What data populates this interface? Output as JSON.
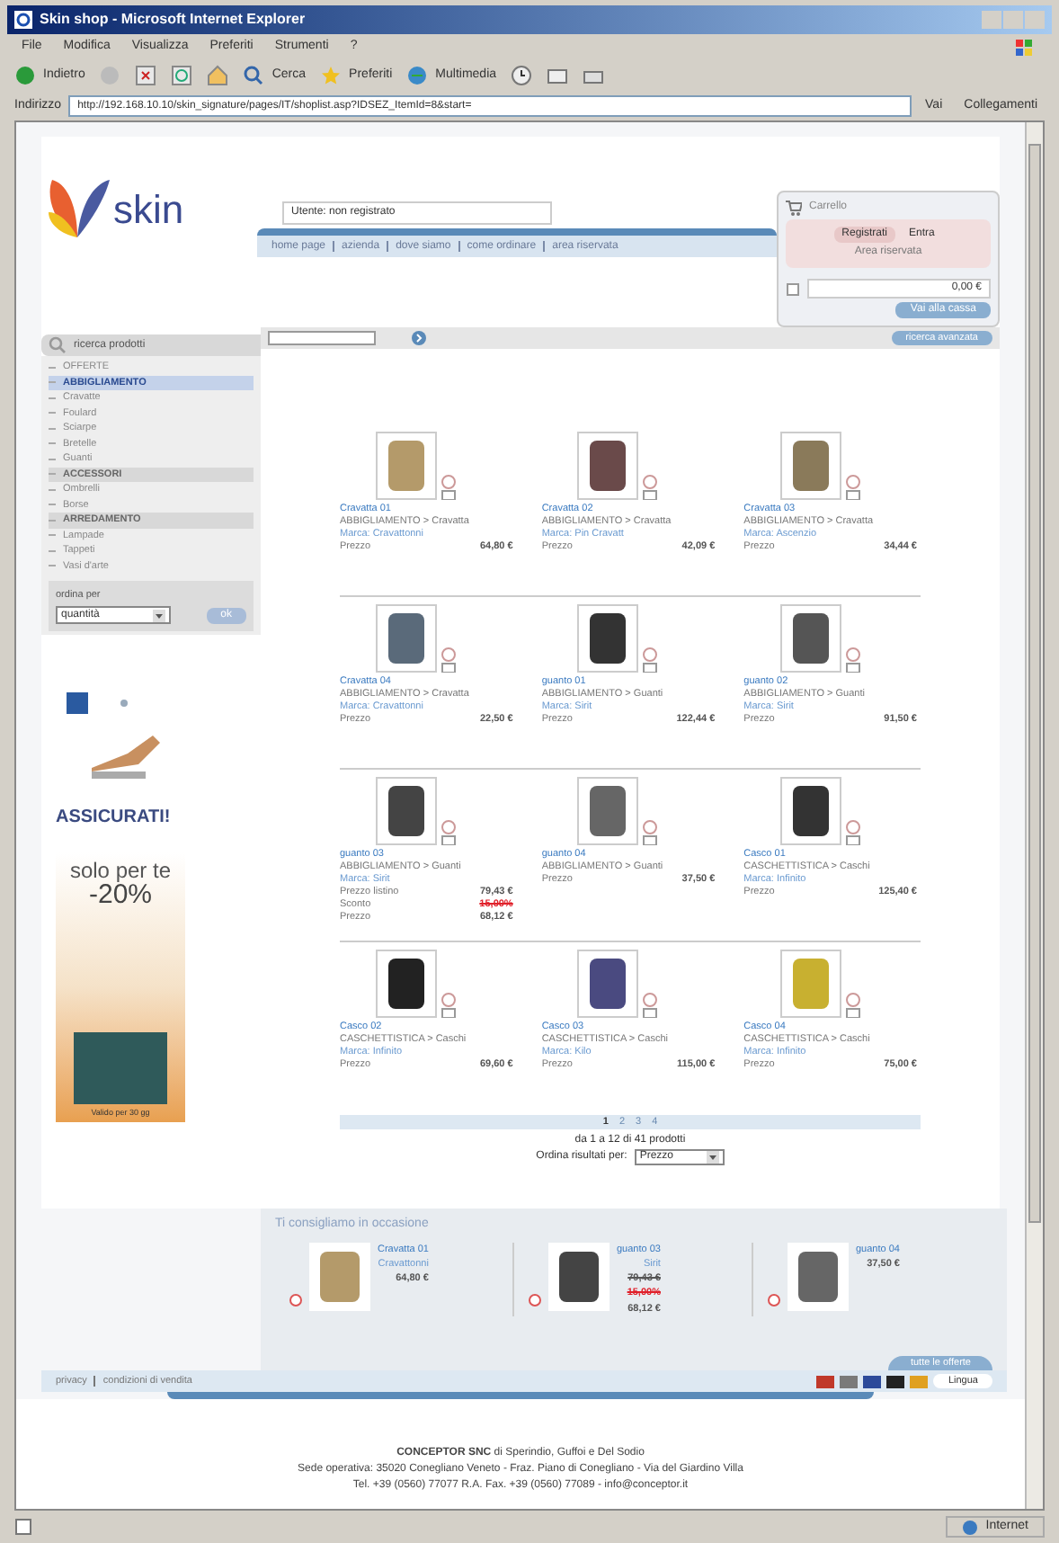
{
  "window": {
    "title": "Skin shop - Microsoft Internet Explorer"
  },
  "menu": [
    "File",
    "Modifica",
    "Visualizza",
    "Preferiti",
    "Strumenti",
    "?"
  ],
  "toolbar": [
    {
      "kind": "back",
      "label": "Indietro"
    },
    {
      "kind": "forward"
    },
    {
      "kind": "stop"
    },
    {
      "kind": "refresh"
    },
    {
      "kind": "home"
    },
    {
      "kind": "search",
      "label": "Cerca"
    },
    {
      "kind": "favorites",
      "label": "Preferiti"
    },
    {
      "kind": "media",
      "label": "Multimedia"
    },
    {
      "kind": "history"
    },
    {
      "kind": "mail"
    },
    {
      "kind": "print"
    }
  ],
  "address_bar": {
    "label": "Indirizzo",
    "value": "http://192.168.10.10/skin_signature/pages/IT/shoplist.asp?IDSEZ_ItemId=8&start=",
    "go": "Vai",
    "links": "Collegamenti"
  },
  "page": {
    "logo": "skin",
    "user": "Utente: non registrato",
    "nav": [
      "home page",
      "azienda",
      "dove siamo",
      "come ordinare",
      "area riservata"
    ],
    "cart": {
      "title": "Carrello",
      "register": "Registrati",
      "login": "Entra",
      "area": "Area riservata",
      "total": "0,00 €",
      "checkout": "Vai alla cassa"
    },
    "search": {
      "label": "ricerca prodotti",
      "advanced": "ricerca avanzata"
    },
    "sidebar": [
      {
        "label": "OFFERTE",
        "kind": "item",
        "selected": false
      },
      {
        "label": "ABBIGLIAMENTO",
        "kind": "header",
        "selected": true
      },
      {
        "label": "Cravatte",
        "kind": "item",
        "selected": false
      },
      {
        "label": "Foulard",
        "kind": "item",
        "selected": false
      },
      {
        "label": "Sciarpe",
        "kind": "item",
        "selected": false
      },
      {
        "label": "Bretelle",
        "kind": "item",
        "selected": false
      },
      {
        "label": "Guanti",
        "kind": "item",
        "selected": false
      },
      {
        "label": "ACCESSORI",
        "kind": "header",
        "selected": false
      },
      {
        "label": "Ombrelli",
        "kind": "item",
        "selected": false
      },
      {
        "label": "Borse",
        "kind": "item",
        "selected": false
      },
      {
        "label": "ARREDAMENTO",
        "kind": "header",
        "selected": false
      },
      {
        "label": "Lampade",
        "kind": "item",
        "selected": false
      },
      {
        "label": "Tappeti",
        "kind": "item",
        "selected": false
      },
      {
        "label": "Vasi d'arte",
        "kind": "item",
        "selected": false
      }
    ],
    "sort_box": {
      "label": "ordina per",
      "value": "quantità",
      "button": "ok"
    },
    "ads": {
      "insurance": "ASSICURATI!",
      "promo_line": "solo per te",
      "promo_discount": "-20%",
      "promo_caption": "Valido per 30 gg"
    },
    "products": [
      {
        "name": "Cravatta 01",
        "category": "ABBIGLIAMENTO > Cravatta",
        "brand": "Marca: Cravattonni",
        "lines": [
          {
            "kind": "price",
            "label": "Prezzo",
            "value": "64,80 €"
          }
        ]
      },
      {
        "name": "Cravatta 02",
        "category": "ABBIGLIAMENTO > Cravatta",
        "brand": "Marca: Pin Cravatt",
        "lines": [
          {
            "kind": "price",
            "label": "Prezzo",
            "value": "42,09 €"
          }
        ]
      },
      {
        "name": "Cravatta 03",
        "category": "ABBIGLIAMENTO > Cravatta",
        "brand": "Marca: Ascenzio",
        "lines": [
          {
            "kind": "price",
            "label": "Prezzo",
            "value": "34,44 €"
          }
        ]
      },
      {
        "name": "Cravatta 04",
        "category": "ABBIGLIAMENTO > Cravatta",
        "brand": "Marca: Cravattonni",
        "lines": [
          {
            "kind": "price",
            "label": "Prezzo",
            "value": "22,50 €"
          }
        ]
      },
      {
        "name": "guanto 01",
        "category": "ABBIGLIAMENTO > Guanti",
        "brand": "Marca: Sirit",
        "lines": [
          {
            "kind": "price",
            "label": "Prezzo",
            "value": "122,44 €"
          }
        ]
      },
      {
        "name": "guanto 02",
        "category": "ABBIGLIAMENTO > Guanti",
        "brand": "Marca: Sirit",
        "lines": [
          {
            "kind": "price",
            "label": "Prezzo",
            "value": "91,50 €"
          }
        ]
      },
      {
        "name": "guanto 03",
        "category": "ABBIGLIAMENTO > Guanti",
        "brand": "Marca: Sirit",
        "lines": [
          {
            "kind": "list",
            "label": "Prezzo listino",
            "value": "79,43 €"
          },
          {
            "kind": "discount",
            "label": "Sconto",
            "value": "15,00%"
          },
          {
            "kind": "price",
            "label": "Prezzo",
            "value": "68,12 €"
          }
        ]
      },
      {
        "name": "guanto 04",
        "category": "ABBIGLIAMENTO > Guanti",
        "lines": [
          {
            "kind": "price",
            "label": "Prezzo",
            "value": "37,50 €"
          }
        ]
      },
      {
        "name": "Casco 01",
        "category": "CASCHETTISTICA > Caschi",
        "brand": "Marca: Infinito",
        "lines": [
          {
            "kind": "price",
            "label": "Prezzo",
            "value": "125,40 €"
          }
        ]
      },
      {
        "name": "Casco 02",
        "category": "CASCHETTISTICA > Caschi",
        "brand": "Marca: Infinito",
        "lines": [
          {
            "kind": "price",
            "label": "Prezzo",
            "value": "69,60 €"
          }
        ]
      },
      {
        "name": "Casco 03",
        "category": "CASCHETTISTICA > Caschi",
        "brand": "Marca: Kilo",
        "lines": [
          {
            "kind": "price",
            "label": "Prezzo",
            "value": "115,00 €"
          }
        ]
      },
      {
        "name": "Casco 04",
        "category": "CASCHETTISTICA > Caschi",
        "brand": "Marca: Infinito",
        "lines": [
          {
            "kind": "price",
            "label": "Prezzo",
            "value": "75,00 €"
          }
        ]
      }
    ],
    "pagination": [
      {
        "label": "1",
        "selected": true
      },
      {
        "label": "2",
        "selected": false
      },
      {
        "label": "3",
        "selected": false
      },
      {
        "label": "4",
        "selected": false
      }
    ],
    "results": "da 1 a 12 di 41 prodotti",
    "order_label": "Ordina risultati per:",
    "order_value": "Prezzo",
    "suggested": {
      "title": "Ti consigliamo in occasione",
      "items": [
        {
          "name": "Cravatta 01",
          "brand": "Cravattonni",
          "lines": [
            {
              "kind": "price",
              "value": "64,80 €"
            }
          ]
        },
        {
          "name": "guanto 03",
          "brand": "Sirit",
          "lines": [
            {
              "kind": "list",
              "value": "79,43 €"
            },
            {
              "kind": "discount",
              "value": "15,00%"
            },
            {
              "kind": "price",
              "value": "68,12 €"
            }
          ]
        },
        {
          "name": "guanto 04",
          "lines": [
            {
              "kind": "price",
              "value": "37,50 €"
            }
          ]
        }
      ],
      "more": "tutte le offerte"
    },
    "bottom_links": [
      "privacy",
      "condizioni di vendita"
    ],
    "languages": [
      {
        "color": "#c0392b"
      },
      {
        "color": "#7a7a7a"
      },
      {
        "color": "#2c4a9a"
      },
      {
        "color": "#222222"
      },
      {
        "color": "#e0a020"
      }
    ],
    "lang_label": "Lingua",
    "footer": [
      "**CONCEPTOR SNC** di Sperindio, Guffoi e Del Sodio",
      "Sede operativa: 35020 Conegliano Veneto - Fraz. Piano di Conegliano - Via del Giardino Villa",
      "Tel. +39 (0560) 77077 R.A. Fax. +39 (0560) 77089 - info@conceptor.it"
    ]
  },
  "status_bar": {
    "zone": "Internet"
  }
}
